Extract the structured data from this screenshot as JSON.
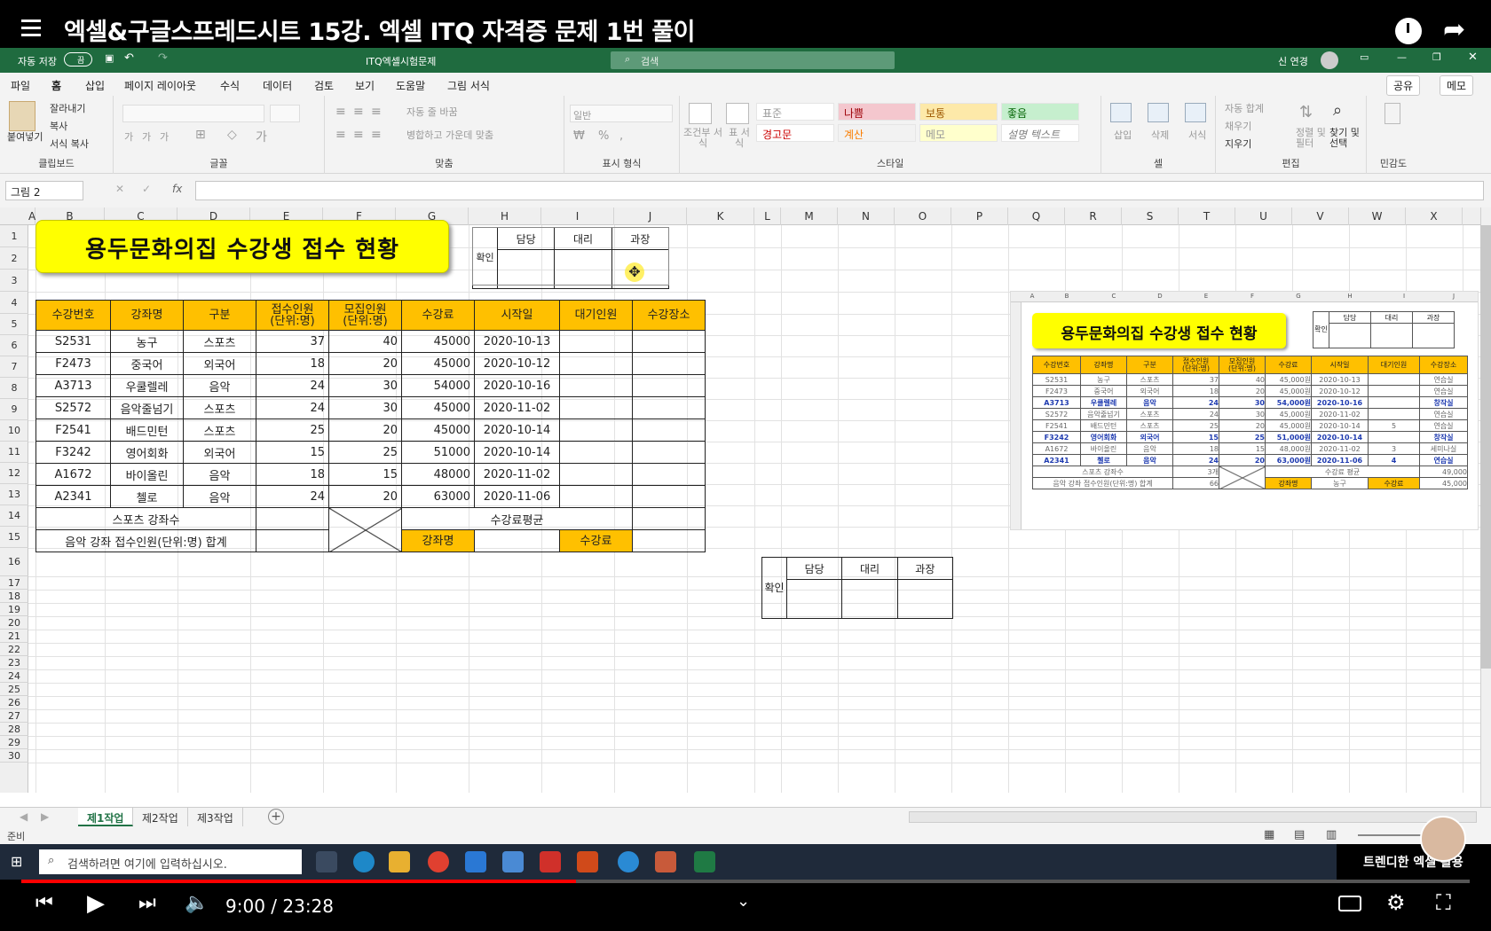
{
  "video": {
    "title": "엑셀&구글스프레드시트 15강. 엑셀 ITQ 자격증 문제 1번 풀이",
    "time": "9:00 / 23:28",
    "progress_fraction": 0.383,
    "channel_badge": "트렌디한 엑셀 활용"
  },
  "excel": {
    "autosave_label": "자동 저장",
    "autosave_state": "끔",
    "file_name": "ITQ엑셀시험문제",
    "search_placeholder": "검색",
    "user_name": "신 연경",
    "tabs": [
      "파일",
      "홈",
      "삽입",
      "페이지 레이아웃",
      "수식",
      "데이터",
      "검토",
      "보기",
      "도움말",
      "그림 서식"
    ],
    "share_label": "공유",
    "memo_label": "메모",
    "ribbon": {
      "paste": "붙여넣기",
      "cut": "잘라내기",
      "copy": "복사",
      "format_painter": "서식 복사",
      "clipboard": "클립보드",
      "font": "글꼴",
      "wrap": "자동 줄 바꿈",
      "merge": "병합하고 가운데 맞춤",
      "alignment": "맞춤",
      "number_format": "일반",
      "number": "표시 형식",
      "cond_format": "조건부 서식",
      "table_format": "표 서식",
      "styles": [
        "표준",
        "나쁨",
        "보통",
        "좋음",
        "경고문",
        "계산",
        "메모",
        "설명 텍스트"
      ],
      "style": "스타일",
      "insert": "삽입",
      "delete": "삭제",
      "format": "서식",
      "cells": "셀",
      "autosum": "자동 합계",
      "fill": "채우기",
      "clear": "지우기",
      "sort": "정렬 및 필터",
      "find": "찾기 및 선택",
      "editing": "편집",
      "sensitivity": "민감도"
    },
    "name_box": "그림 2",
    "columns": [
      "A",
      "B",
      "C",
      "D",
      "E",
      "F",
      "G",
      "H",
      "I",
      "J",
      "K",
      "L",
      "M",
      "N",
      "O",
      "P",
      "Q",
      "R",
      "S",
      "T",
      "U",
      "V",
      "W",
      "X"
    ],
    "rows": [
      "1",
      "2",
      "3",
      "4",
      "5",
      "6",
      "7",
      "8",
      "9",
      "10",
      "11",
      "12",
      "13",
      "14",
      "15",
      "16",
      "17",
      "18",
      "19",
      "20",
      "21",
      "22",
      "23",
      "24",
      "25",
      "26",
      "27",
      "28",
      "29",
      "30"
    ],
    "sheet_tabs": [
      "제1작업",
      "제2작업",
      "제3작업"
    ],
    "status": "준비"
  },
  "sheet": {
    "title": "용두문화의집 수강생 접수 현황",
    "confirm": {
      "side": "확인",
      "cols": [
        "담당",
        "대리",
        "과장"
      ]
    },
    "headers": [
      "수강번호",
      "강좌명",
      "구분",
      "접수인원\n(단위:명)",
      "모집인원\n(단위:명)",
      "수강료",
      "시작일",
      "대기인원",
      "수강장소"
    ],
    "rows": [
      [
        "S2531",
        "농구",
        "스포츠",
        "37",
        "40",
        "45000",
        "2020-10-13",
        "",
        ""
      ],
      [
        "F2473",
        "중국어",
        "외국어",
        "18",
        "20",
        "45000",
        "2020-10-12",
        "",
        ""
      ],
      [
        "A3713",
        "우쿨렐레",
        "음악",
        "24",
        "30",
        "54000",
        "2020-10-16",
        "",
        ""
      ],
      [
        "S2572",
        "음악줄넘기",
        "스포츠",
        "24",
        "30",
        "45000",
        "2020-11-02",
        "",
        ""
      ],
      [
        "F2541",
        "배드민턴",
        "스포츠",
        "25",
        "20",
        "45000",
        "2020-10-14",
        "",
        ""
      ],
      [
        "F3242",
        "영어회화",
        "외국어",
        "15",
        "25",
        "51000",
        "2020-10-14",
        "",
        ""
      ],
      [
        "A1672",
        "바이올린",
        "음악",
        "18",
        "15",
        "48000",
        "2020-11-02",
        "",
        ""
      ],
      [
        "A2341",
        "첼로",
        "음악",
        "24",
        "20",
        "63000",
        "2020-11-06",
        "",
        ""
      ]
    ],
    "summary1_label": "스포츠 강좌수",
    "summary2_label": "음악 강좌 접수인원(단위:명) 합계",
    "avg_label": "수강료평균",
    "course_label": "강좌명",
    "fee_label": "수강료"
  },
  "thumbnail": {
    "title": "용두문화의집 수강생 접수 현황",
    "confirm": {
      "side": "확인",
      "cols": [
        "담당",
        "대리",
        "과장"
      ]
    },
    "columns": [
      "A",
      "B",
      "C",
      "D",
      "E",
      "F",
      "G",
      "H",
      "I",
      "J"
    ],
    "headers": [
      "수강번호",
      "강좌명",
      "구분",
      "접수인원\n(단위:명)",
      "모집인원\n(단위:명)",
      "수강료",
      "시작일",
      "대기인원",
      "수강장소"
    ],
    "rows": [
      [
        "S2531",
        "농구",
        "스포츠",
        "37",
        "40",
        "45,000원",
        "2020-10-13",
        "",
        "연습실"
      ],
      [
        "F2473",
        "중국어",
        "외국어",
        "18",
        "20",
        "45,000원",
        "2020-10-12",
        "",
        "연습실"
      ],
      [
        "A3713",
        "우쿨렐레",
        "음악",
        "24",
        "30",
        "54,000원",
        "2020-10-16",
        "",
        "창작실"
      ],
      [
        "S2572",
        "음악줄넘기",
        "스포츠",
        "24",
        "30",
        "45,000원",
        "2020-11-02",
        "",
        "연습실"
      ],
      [
        "F2541",
        "배드민턴",
        "스포츠",
        "25",
        "20",
        "45,000원",
        "2020-10-14",
        "5",
        "연습실"
      ],
      [
        "F3242",
        "영어회화",
        "외국어",
        "15",
        "25",
        "51,000원",
        "2020-10-14",
        "",
        "창작실"
      ],
      [
        "A1672",
        "바이올린",
        "음악",
        "18",
        "15",
        "48,000원",
        "2020-11-02",
        "3",
        "세미나실"
      ],
      [
        "A2341",
        "첼로",
        "음악",
        "24",
        "20",
        "63,000원",
        "2020-11-06",
        "4",
        "연습실"
      ]
    ],
    "summary1_label": "스포츠 강좌수",
    "summary1_value": "3개",
    "summary2_label": "음악 강좌 접수인원(단위:명) 합계",
    "summary2_value": "66",
    "avg_label": "수강료 평균",
    "avg_value": "49,000",
    "course_label": "강좌명",
    "course_value": "농구",
    "fee_label": "수강료",
    "fee_value": "45,000"
  },
  "standalone_confirm": {
    "side": "확인",
    "cols": [
      "담당",
      "대리",
      "과장"
    ]
  },
  "taskbar": {
    "search_placeholder": "검색하려면 여기에 입력하십시오."
  },
  "colors": {
    "header_fill": "#ffc000",
    "title_fill": "#ffff00",
    "excel_green": "#1f6b3f",
    "progress": "#ff0000"
  }
}
